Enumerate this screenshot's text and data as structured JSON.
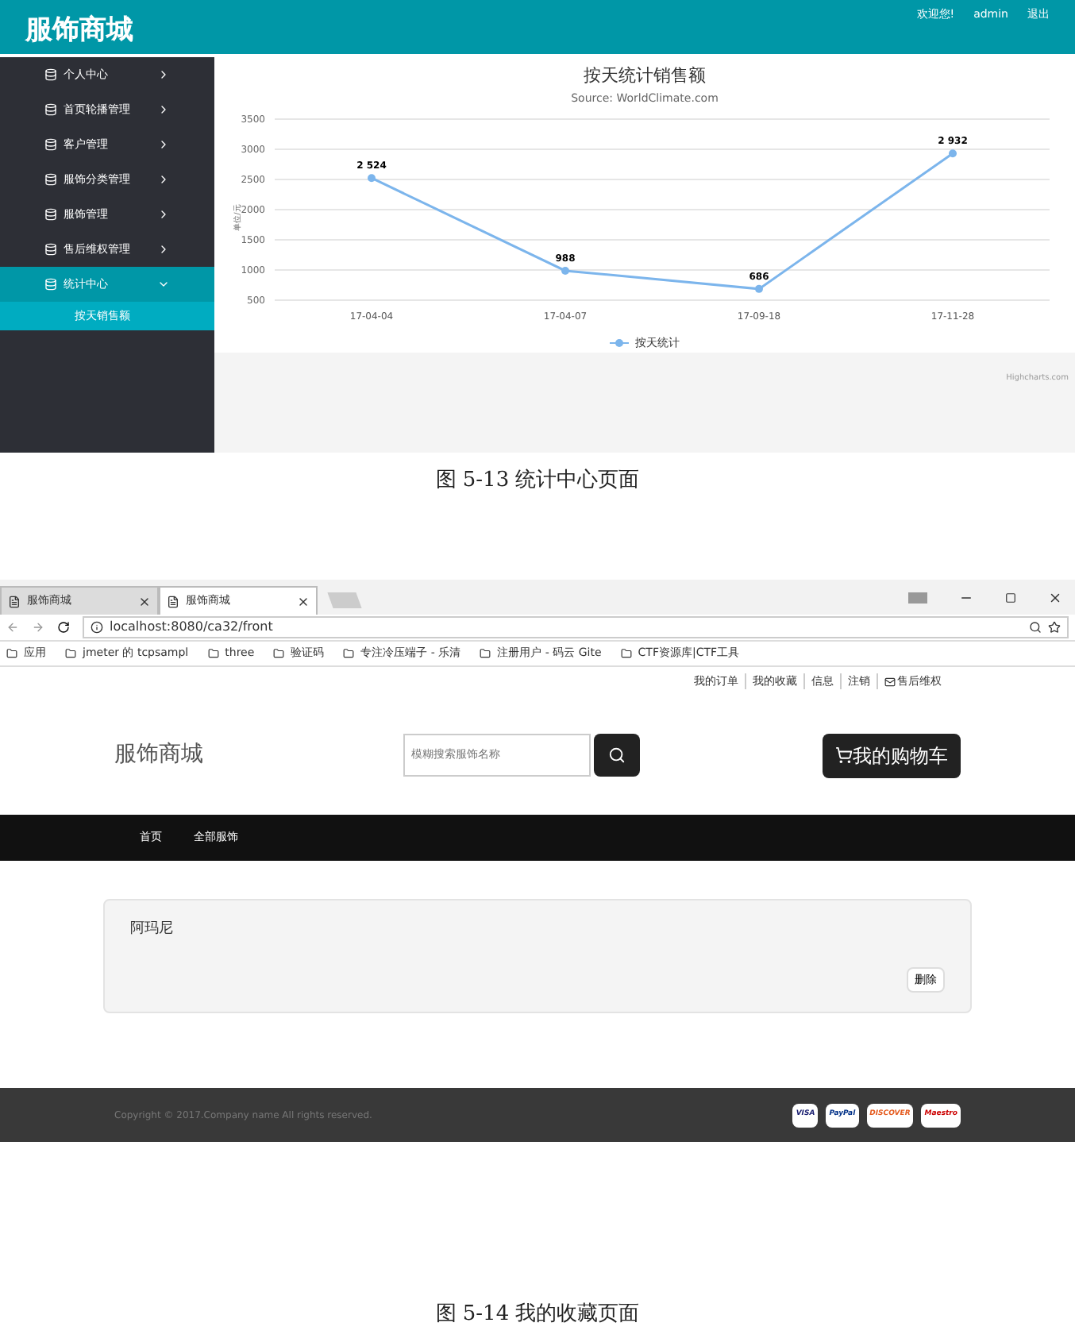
{
  "figure_1": {
    "header": {
      "title": "服饰商城",
      "welcome": "欢迎您!",
      "user": "admin",
      "logout": "退出"
    },
    "sidebar": {
      "items": [
        {
          "label": "个人中心",
          "expanded": false
        },
        {
          "label": "首页轮播管理",
          "expanded": false
        },
        {
          "label": "客户管理",
          "expanded": false
        },
        {
          "label": "服饰分类管理",
          "expanded": false
        },
        {
          "label": "服饰管理",
          "expanded": false
        },
        {
          "label": "售后维权管理",
          "expanded": false
        },
        {
          "label": "统计中心",
          "expanded": true,
          "children": [
            {
              "label": "按天销售额"
            }
          ]
        }
      ]
    },
    "chart": {
      "credit": "Highcharts.com",
      "chart_data": {
        "type": "line",
        "title": "按天统计销售额",
        "subtitle": "Source: WorldClimate.com",
        "ylabel": "单位/元",
        "categories": [
          "17-04-04",
          "17-04-07",
          "17-09-18",
          "17-11-28"
        ],
        "series": [
          {
            "name": "按天统计",
            "color": "#7cb5ec",
            "marker": "circle",
            "values": [
              2524,
              988,
              686,
              2932
            ]
          }
        ],
        "grid": true,
        "ylim": [
          500,
          3500
        ],
        "yticks": [
          500,
          1000,
          1500,
          2000,
          2500,
          3000,
          3500
        ],
        "data_labels": true
      }
    },
    "caption": "图 5-13 统计中心页面"
  },
  "figure_2": {
    "browser": {
      "tabs": [
        {
          "title": "服饰商城",
          "selected": false
        },
        {
          "title": "服饰商城",
          "selected": true
        }
      ],
      "address": "localhost:8080/ca32/front",
      "bookmarks": [
        "应用",
        "jmeter 的 tcpsampl",
        "three",
        "验证码",
        "专注冷压端子 - 乐清",
        "注册用户 - 码云 Gite",
        "CTF资源库|CTF工具"
      ]
    },
    "top_links": [
      "我的订单",
      "我的收藏",
      "信息",
      "注销",
      "售后维权"
    ],
    "logo": "服饰商城",
    "search": {
      "placeholder": "模糊搜索服饰名称"
    },
    "cart_button": "我的购物车",
    "nav": [
      "首页",
      "全部服饰"
    ],
    "favorites": [
      {
        "name": "阿玛尼",
        "action": "删除"
      }
    ],
    "footer": {
      "copyright": "Copyright © 2017.Company name All rights reserved.",
      "payments": [
        "VISA",
        "PayPal",
        "DISCOVER",
        "Maestro"
      ]
    },
    "caption": "图 5-14 我的收藏页面"
  }
}
